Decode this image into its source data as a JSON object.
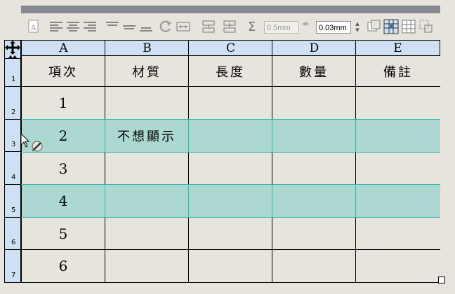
{
  "toolbar": {
    "stroke_weight_value": "0.5mm",
    "cell_inset_value": "0.03mm"
  },
  "columns": [
    "A",
    "B",
    "C",
    "D",
    "E"
  ],
  "rows": [
    {
      "num": "1",
      "cells": [
        "項次",
        "材質",
        "長度",
        "數量",
        "備註"
      ],
      "selected": false
    },
    {
      "num": "2",
      "cells": [
        "1",
        "",
        "",
        "",
        ""
      ],
      "selected": false
    },
    {
      "num": "3",
      "cells": [
        "2",
        "不想顯示",
        "",
        "",
        ""
      ],
      "selected": true
    },
    {
      "num": "4",
      "cells": [
        "3",
        "",
        "",
        "",
        ""
      ],
      "selected": false
    },
    {
      "num": "5",
      "cells": [
        "4",
        "",
        "",
        "",
        ""
      ],
      "selected": true
    },
    {
      "num": "6",
      "cells": [
        "5",
        "",
        "",
        "",
        ""
      ],
      "selected": false
    },
    {
      "num": "7",
      "cells": [
        "6",
        "",
        "",
        "",
        ""
      ],
      "selected": false
    }
  ],
  "colors": {
    "header_bg": "#cfe0f5",
    "selection_fill": "#acd8d1",
    "selection_border": "#2bb9a9",
    "panel_bg": "#e6e4dc"
  }
}
